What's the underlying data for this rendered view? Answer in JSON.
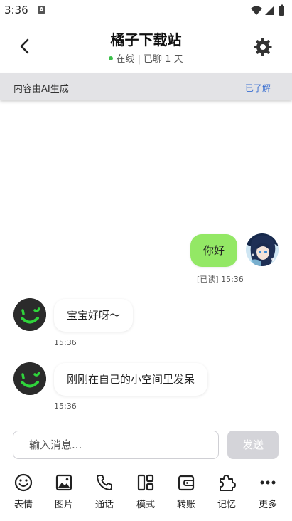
{
  "status_bar": {
    "time": "3:36",
    "notif_letter": "A"
  },
  "header": {
    "title": "橘子下载站",
    "status": "在线 | 已聊 1 天"
  },
  "ai_notice": {
    "text": "内容由AI生成",
    "ack_label": "已了解"
  },
  "messages": [
    {
      "from": "me",
      "text": "你好",
      "meta": "[已读] 15:36"
    },
    {
      "from": "bot",
      "text": "宝宝好呀～",
      "meta": "15:36"
    },
    {
      "from": "bot",
      "text": "刚刚在自己的小空间里发呆",
      "meta": "15:36"
    }
  ],
  "composer": {
    "placeholder": "输入消息...",
    "send_label": "发送"
  },
  "toolbar": [
    {
      "icon": "emoji-icon",
      "label": "表情"
    },
    {
      "icon": "image-icon",
      "label": "图片"
    },
    {
      "icon": "phone-icon",
      "label": "通话"
    },
    {
      "icon": "mode-icon",
      "label": "模式"
    },
    {
      "icon": "wallet-icon",
      "label": "转账"
    },
    {
      "icon": "puzzle-icon",
      "label": "记忆"
    },
    {
      "icon": "more-icon",
      "label": "更多"
    }
  ],
  "colors": {
    "my_bubble": "#93e865",
    "bot_accent": "#2fd33b",
    "link": "#3a6fd1",
    "online": "#3bbf4a"
  }
}
